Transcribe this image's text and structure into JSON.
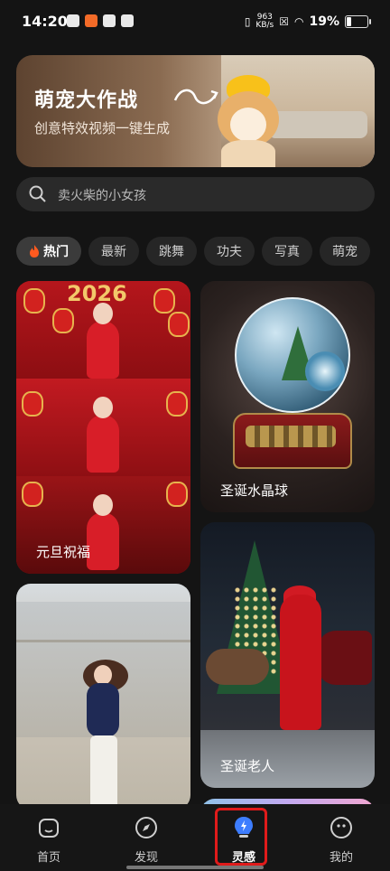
{
  "status_bar": {
    "time": "14:20",
    "net_speed_value": "963",
    "net_speed_unit": "KB/s",
    "battery_percent": "19%",
    "battery_level": 0.19
  },
  "banner": {
    "title": "萌宠大作战",
    "subtitle": "创意特效视频一键生成"
  },
  "search": {
    "placeholder": "卖火柴的小女孩"
  },
  "tabs": [
    {
      "label": "热门",
      "active": true
    },
    {
      "label": "最新"
    },
    {
      "label": "跳舞"
    },
    {
      "label": "功夫"
    },
    {
      "label": "写真"
    },
    {
      "label": "萌宠"
    }
  ],
  "cards": [
    {
      "label": "元旦祝福",
      "year": "2026"
    },
    {
      "label": "圣诞水晶球"
    },
    {
      "label": ""
    },
    {
      "label": "圣诞老人"
    }
  ],
  "bottom_nav": [
    {
      "label": "首页",
      "icon": "home-icon"
    },
    {
      "label": "发现",
      "icon": "compass-icon"
    },
    {
      "label": "灵感",
      "icon": "bulb-icon",
      "active": true
    },
    {
      "label": "我的",
      "icon": "profile-icon"
    }
  ],
  "colors": {
    "background": "#141414",
    "highlight": "#e01b1b",
    "accent_blue": "#3d7dff"
  }
}
